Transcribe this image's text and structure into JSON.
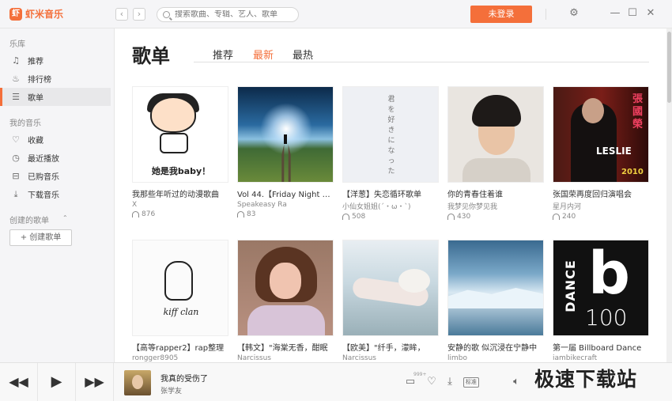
{
  "app": {
    "name": "虾米音乐",
    "logo_char": "虾"
  },
  "search": {
    "placeholder": "搜索歌曲、专辑、艺人、歌单"
  },
  "header": {
    "login_label": "未登录"
  },
  "sidebar": {
    "library_title": "乐库",
    "library_items": [
      {
        "label": "推荐",
        "icon": "music-note-icon"
      },
      {
        "label": "排行榜",
        "icon": "fire-icon"
      },
      {
        "label": "歌单",
        "icon": "playlist-icon",
        "active": true
      }
    ],
    "my_music_title": "我的音乐",
    "my_items": [
      {
        "label": "收藏",
        "icon": "heart-icon"
      },
      {
        "label": "最近播放",
        "icon": "clock-icon"
      },
      {
        "label": "已购音乐",
        "icon": "cart-icon"
      },
      {
        "label": "下载音乐",
        "icon": "download-icon"
      }
    ],
    "created_title": "创建的歌单",
    "create_button": "+ 创建歌单"
  },
  "main": {
    "title": "歌单",
    "tabs": [
      {
        "label": "推荐",
        "active": false
      },
      {
        "label": "最新",
        "active": true
      },
      {
        "label": "最热",
        "active": false
      }
    ],
    "playlists": [
      {
        "title": "我那些年听过的动漫歌曲",
        "author": "X",
        "plays": "876",
        "cover_text": "她是我baby！"
      },
      {
        "title": "Vol 44.【Friday Night Dancing】",
        "author": "Speakeasy Ra",
        "plays": "83"
      },
      {
        "title": "【洋葱】失恋循环歌单",
        "author": "小仙女姐姐(´・ω・`)",
        "plays": "508",
        "cover_text": "君を好きになった"
      },
      {
        "title": "你的青春住着谁",
        "author": "我梦见你梦见我",
        "plays": "430"
      },
      {
        "title": "张国荣再度回归演唱会",
        "author": "星月内河",
        "plays": "240",
        "cover_text_cn": "張國榮",
        "cover_text_en": "LESLIE",
        "cover_year": "2010"
      },
      {
        "title": "【高等rapper2】rap整理",
        "author": "rongger8905",
        "plays": "",
        "cover_text": "kiff clan"
      },
      {
        "title": "【韩文】\"海棠无香，酣眠",
        "author": "Narcissus",
        "plays": ""
      },
      {
        "title": "【欧美】\"纤手，濛眸，",
        "author": "Narcissus",
        "plays": ""
      },
      {
        "title": "安静的歌 似沉浸在宁静中",
        "author": "limbo",
        "plays": ""
      },
      {
        "title": "第一届 Billboard Dance",
        "author": "iambikecraft",
        "plays": "",
        "cover_text": "DANCE",
        "cover_letter": "b",
        "cover_num": "100"
      }
    ]
  },
  "player": {
    "track_title": "我真的受伤了",
    "artist": "张学友",
    "comment_badge": "999+",
    "quality_label": "标准"
  },
  "watermark": "极速下载站"
}
